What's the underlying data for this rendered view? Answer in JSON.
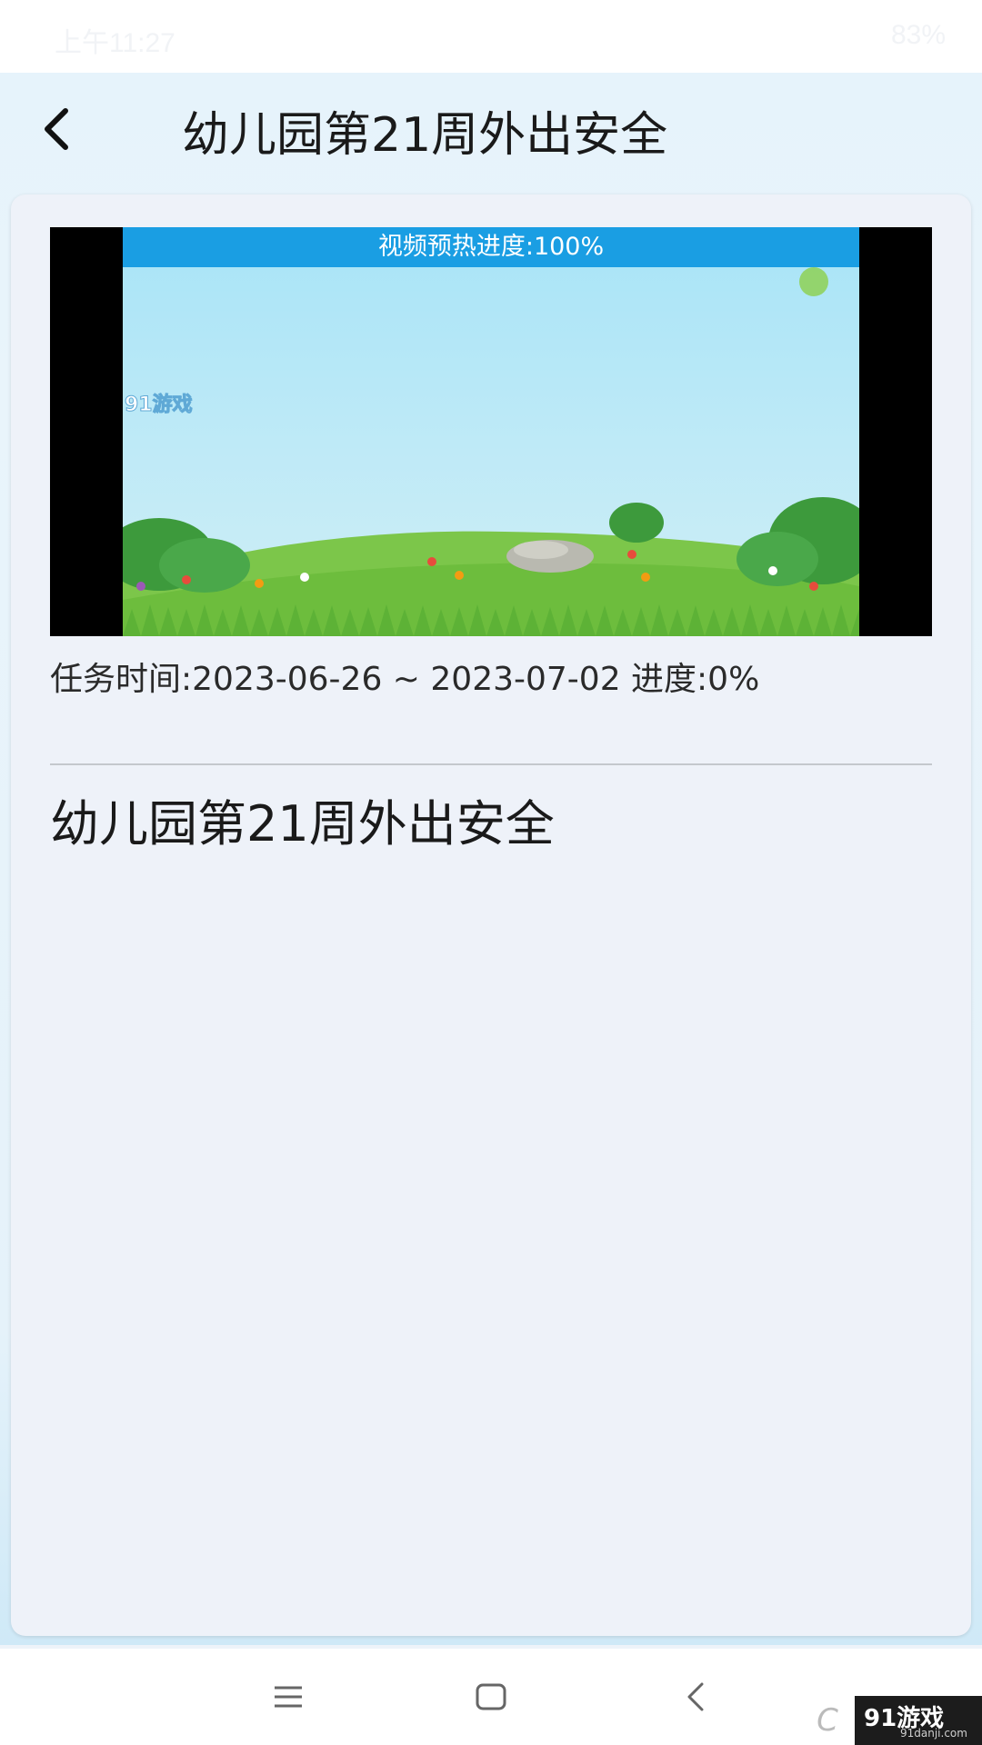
{
  "status_bar": {
    "left_text": "上午11:27",
    "right_text": "83%"
  },
  "header": {
    "title": "幼儿园第21周外出安全"
  },
  "video": {
    "preheat_text": "视频预热进度:100%",
    "preheat_progress": 1.0,
    "in_video_logo": "91游戏"
  },
  "task": {
    "info_text": "任务时间:2023-06-26 ~ 2023-07-02 进度:0%"
  },
  "content": {
    "title": "幼儿园第21周外出安全"
  },
  "nav": {
    "items": [
      {
        "icon": "menu-icon"
      },
      {
        "icon": "home-square-icon"
      },
      {
        "icon": "back-chevron-icon"
      }
    ]
  },
  "watermark": {
    "brand": "91游戏",
    "site": "91danji.com"
  },
  "colors": {
    "banner": "#1a9ee3",
    "background": "#e6f3fb",
    "card": "#eef2f9"
  }
}
